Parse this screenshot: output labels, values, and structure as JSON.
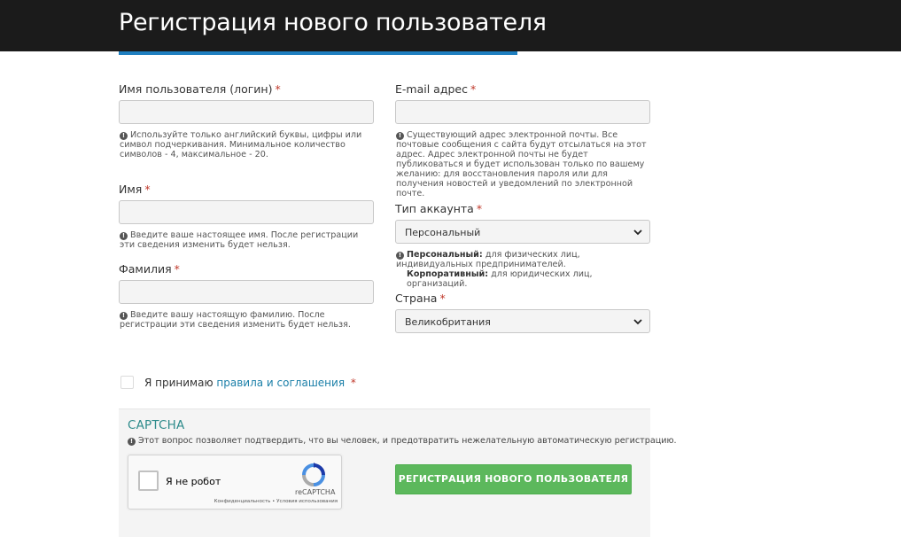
{
  "header": {
    "title": "Регистрация нового пользователя"
  },
  "form": {
    "username": {
      "label": "Имя пользователя (логин)",
      "required_mark": "*",
      "value": "",
      "help": "Используйте только английский буквы, цифры или символ подчеркивания. Минимальное количество символов - 4, максимальное - 20."
    },
    "first_name": {
      "label": "Имя",
      "required_mark": "*",
      "value": "",
      "help": "Введите ваше настоящее имя. После регистрации эти сведения изменить будет нельзя."
    },
    "last_name": {
      "label": "Фамилия",
      "required_mark": "*",
      "value": "",
      "help": "Введите вашу настоящую фамилию. После регистрации эти сведения изменить будет нельзя."
    },
    "email": {
      "label": "E-mail адрес",
      "required_mark": "*",
      "value": "",
      "help": "Существующий адрес электронной почты. Все почтовые сообщения с сайта будут отсылаться на этот адрес. Адрес электронной почты не будет публиковаться и будет использован только по вашему желанию: для восстановления пароля или для получения новостей и уведомлений по электронной почте."
    },
    "account_type": {
      "label": "Тип аккаунта",
      "required_mark": "*",
      "selected": "Персональный",
      "help_personal_title": "Персональный:",
      "help_personal_text": "для физических лиц, индивидуальных предпринимателей.",
      "help_corporate_title": "Корпоративный:",
      "help_corporate_text": "для юридических лиц, организаций."
    },
    "country": {
      "label": "Страна",
      "required_mark": "*",
      "selected": "Великобритания"
    },
    "terms": {
      "prefix": "Я принимаю",
      "link_text": "правила и соглашения",
      "required_mark": "*",
      "checked": false
    }
  },
  "captcha": {
    "title": "CAPTCHA",
    "help": "Этот вопрос позволяет подтвердить, что вы человек, и предотвратить нежелательную автоматическую регистрацию.",
    "recaptcha_label": "Я не робот",
    "recaptcha_brand": "reCAPTCHA",
    "recaptcha_privacy": "Конфиденциальность",
    "recaptcha_separator": "•",
    "recaptcha_terms": "Условия использования"
  },
  "actions": {
    "register_label": "РЕГИСТРАЦИЯ НОВОГО ПОЛЬЗОВАТЕЛЯ"
  },
  "colors": {
    "header_bg": "#1b1b1b",
    "accent_blue": "#1f7fc0",
    "required_red": "#c0392b",
    "link": "#1a7fa8",
    "captcha_title": "#2e8b8b",
    "button_green": "#5cb85c"
  },
  "icons": {
    "info": "info-icon",
    "select_arrow": "chevron-down-icon",
    "recaptcha": "recaptcha-logo-icon"
  }
}
